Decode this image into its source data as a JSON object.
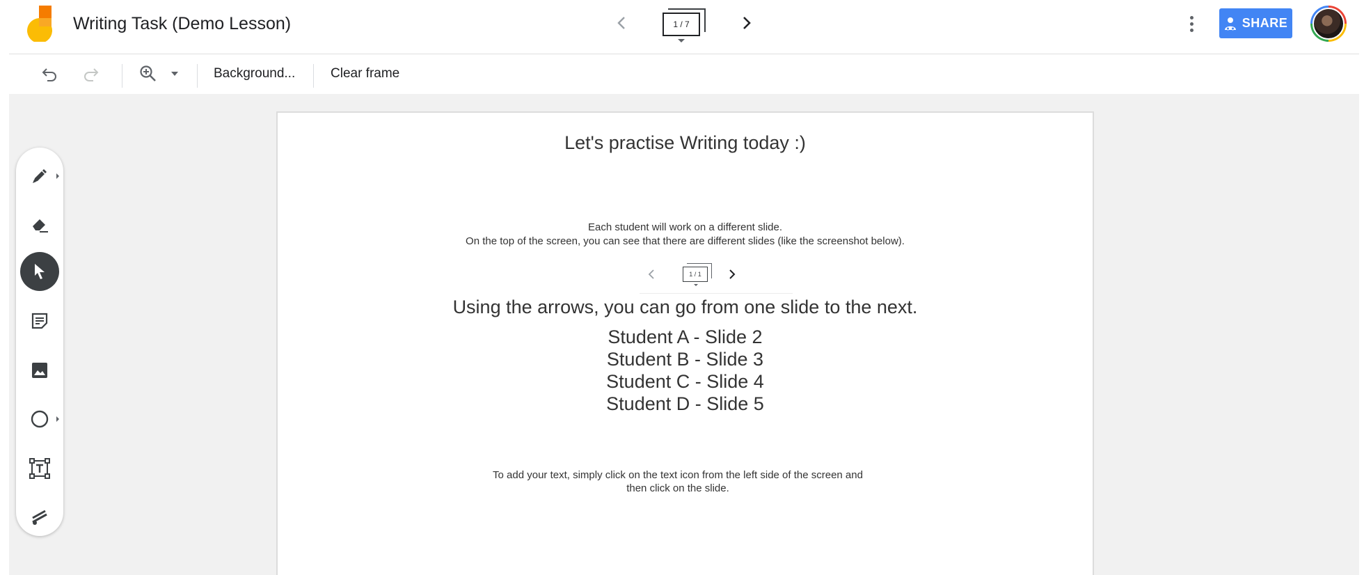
{
  "app": {
    "title": "Writing Task (Demo Lesson)",
    "brand_colors": {
      "logo_yellow": "#fbbc05",
      "logo_orange": "#f57c00",
      "share_blue": "#4285f4"
    }
  },
  "frame_nav": {
    "indicator": "1 / 7",
    "prev_icon": "chevron-left-icon",
    "next_icon": "chevron-right-icon"
  },
  "header": {
    "more_icon": "more-vert-icon",
    "share_label": "SHARE",
    "share_icon": "person-share-icon"
  },
  "toolbar": {
    "undo_icon": "undo-icon",
    "redo_icon": "redo-icon",
    "zoom_icon": "zoom-in-icon",
    "background_label": "Background...",
    "clear_label": "Clear frame"
  },
  "tools": [
    {
      "name": "pen-tool",
      "icon": "pen-icon"
    },
    {
      "name": "eraser-tool",
      "icon": "eraser-icon"
    },
    {
      "name": "select-tool",
      "icon": "cursor-icon",
      "active": true
    },
    {
      "name": "sticky-note-tool",
      "icon": "sticky-note-icon"
    },
    {
      "name": "image-tool",
      "icon": "image-icon"
    },
    {
      "name": "shape-tool",
      "icon": "circle-icon"
    },
    {
      "name": "text-tool",
      "icon": "text-box-icon"
    },
    {
      "name": "laser-tool",
      "icon": "laser-icon"
    }
  ],
  "slide": {
    "title": "Let's practise Writing today :)",
    "line1": "Each student will work on a different slide.",
    "line2": "On the top of the screen, you can see that there are different slides (like the screenshot below).",
    "mini_indicator": "1 / 1",
    "heading": "Using the arrows, you can go from one slide to the next.",
    "students": [
      "Student A - Slide 2",
      "Student B - Slide 3",
      "Student C - Slide 4",
      "Student D - Slide 5"
    ],
    "footer_line1": "To add your text, simply click on the text icon from the left side of the screen and",
    "footer_line2": "then click on the slide."
  }
}
